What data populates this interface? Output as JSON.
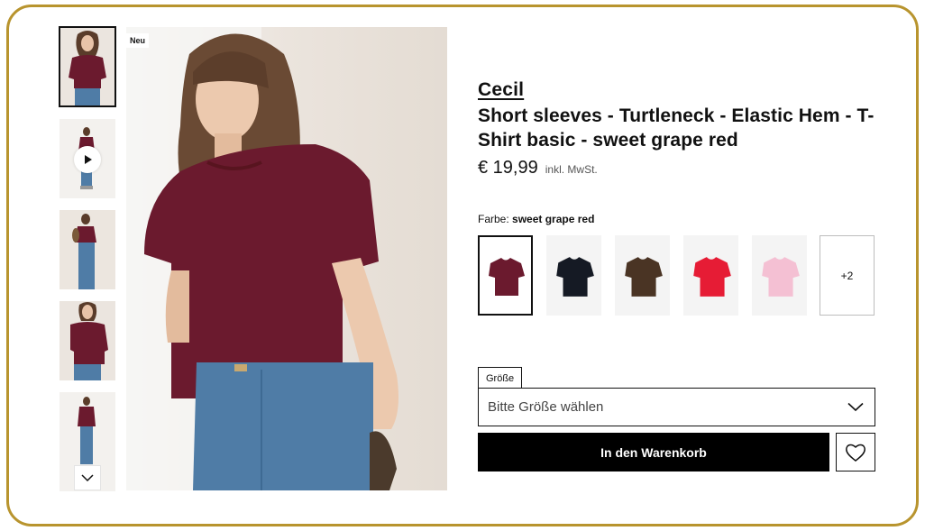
{
  "product": {
    "badge": "Neu",
    "brand": "Cecil",
    "title": "Short sleeves - Turtleneck - Elastic Hem - T-Shirt basic - sweet grape red",
    "price": "€ 19,99",
    "vat_note": "inkl. MwSt."
  },
  "color": {
    "label": "Farbe:",
    "selected": "sweet grape red",
    "swatches": [
      {
        "name": "sweet-grape-red",
        "color": "#6b1a2e"
      },
      {
        "name": "black",
        "color": "#151a24"
      },
      {
        "name": "brown",
        "color": "#4a3424"
      },
      {
        "name": "red",
        "color": "#e61c35"
      },
      {
        "name": "pink",
        "color": "#f4c0d3"
      }
    ],
    "more_label": "+2"
  },
  "size": {
    "label": "Größe",
    "placeholder": "Bitte Größe wählen"
  },
  "actions": {
    "add_to_cart": "In den Warenkorb"
  },
  "colors": {
    "frame_border": "#b8942e",
    "shirt": "#6b1a2e",
    "jeans": "#4f7ca6"
  },
  "icons": [
    "play-icon",
    "chevron-down-icon",
    "heart-icon"
  ]
}
